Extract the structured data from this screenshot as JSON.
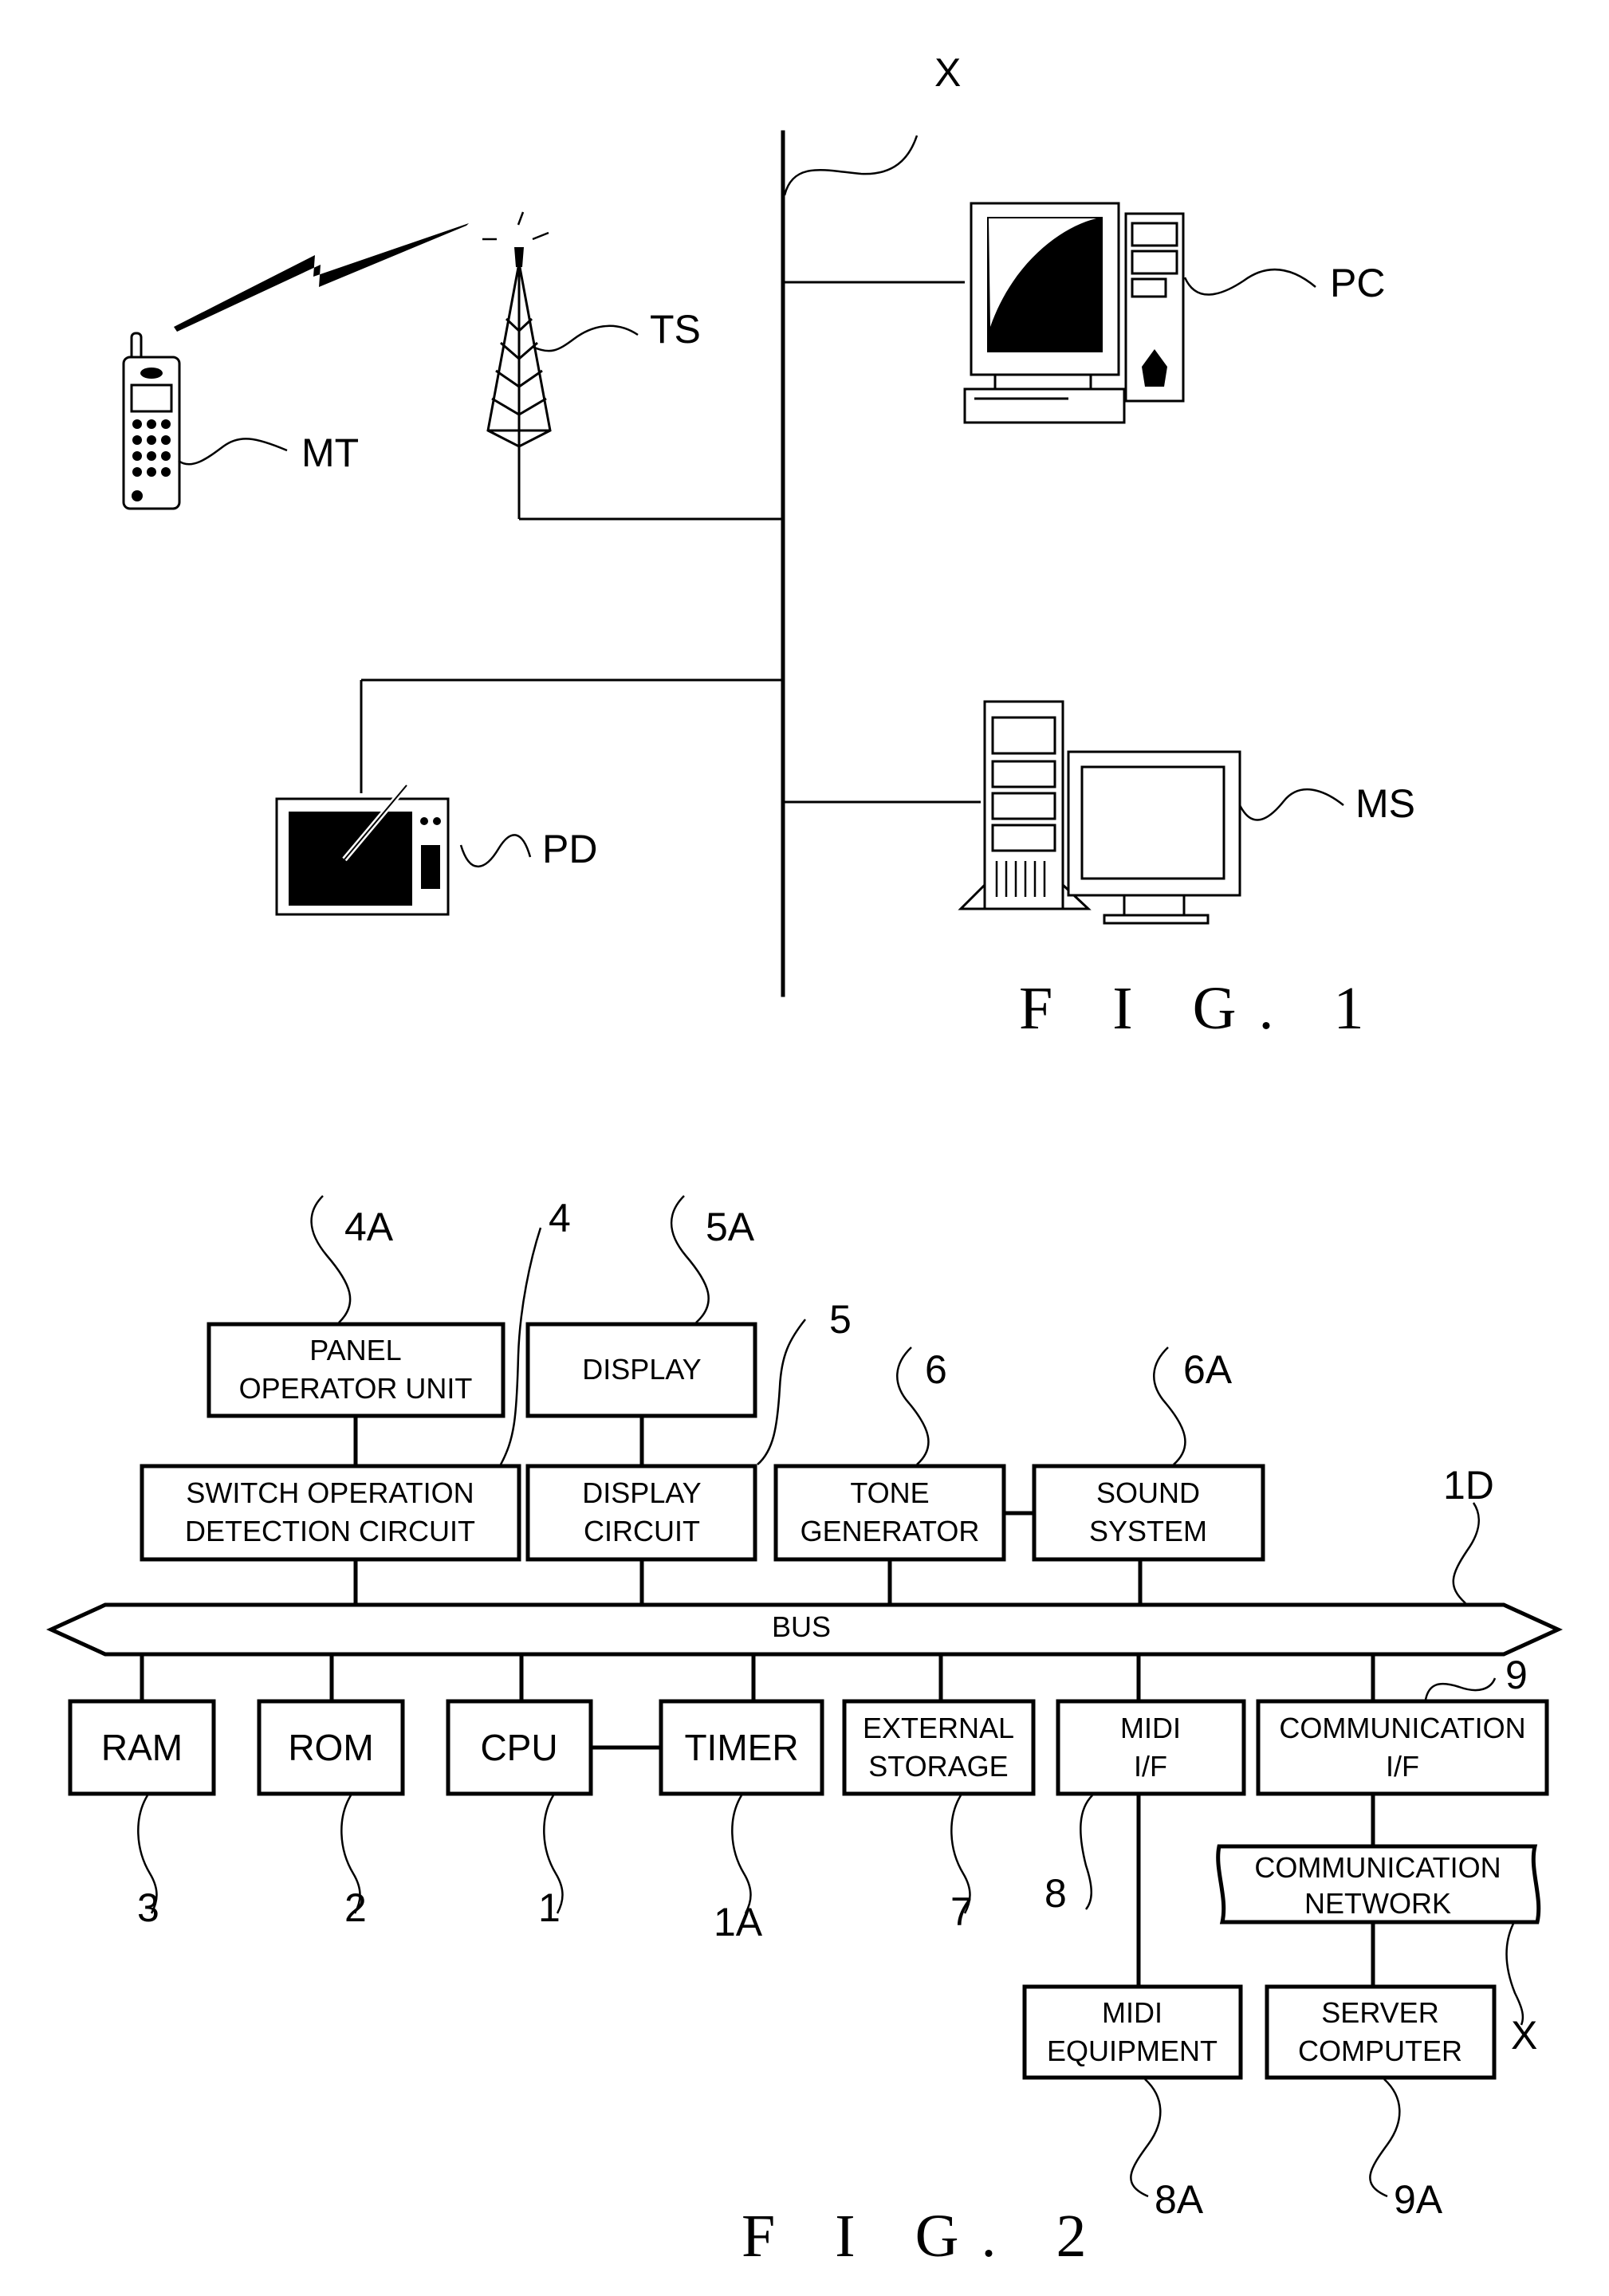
{
  "figure1": {
    "caption": "F I G.  1",
    "network_label": "X",
    "devices": [
      {
        "id": "MT",
        "label": "MT",
        "kind": "mobile-phone"
      },
      {
        "id": "TS",
        "label": "TS",
        "kind": "transmission-tower"
      },
      {
        "id": "PC",
        "label": "PC",
        "kind": "personal-computer"
      },
      {
        "id": "PD",
        "label": "PD",
        "kind": "pen-tablet-device"
      },
      {
        "id": "MS",
        "label": "MS",
        "kind": "server-computer"
      }
    ]
  },
  "figure2": {
    "caption": "F I G.  2",
    "bus": {
      "label": "BUS",
      "ref": "1D"
    },
    "upper_blocks": [
      {
        "lines": [
          "PANEL",
          "OPERATOR UNIT"
        ],
        "ref": "4A"
      },
      {
        "lines": [
          "DISPLAY"
        ],
        "ref": "5A"
      }
    ],
    "middle_blocks": [
      {
        "lines": [
          "SWITCH OPERATION",
          "DETECTION CIRCUIT"
        ],
        "ref": "4"
      },
      {
        "lines": [
          "DISPLAY",
          "CIRCUIT"
        ],
        "ref": "5"
      },
      {
        "lines": [
          "TONE",
          "GENERATOR"
        ],
        "ref": "6"
      },
      {
        "lines": [
          "SOUND",
          "SYSTEM"
        ],
        "ref": "6A"
      }
    ],
    "lower_blocks": [
      {
        "lines": [
          "RAM"
        ],
        "ref": "3"
      },
      {
        "lines": [
          "ROM"
        ],
        "ref": "2"
      },
      {
        "lines": [
          "CPU"
        ],
        "ref": "1"
      },
      {
        "lines": [
          "TIMER"
        ],
        "ref": "1A"
      },
      {
        "lines": [
          "EXTERNAL",
          "STORAGE"
        ],
        "ref": "7"
      },
      {
        "lines": [
          "MIDI",
          "I/F"
        ],
        "ref": "8"
      },
      {
        "lines": [
          "COMMUNICATION",
          "I/F"
        ],
        "ref": "9"
      }
    ],
    "network_block": {
      "lines": [
        "COMMUNICATION",
        "NETWORK"
      ],
      "ref": "X"
    },
    "external_blocks": [
      {
        "lines": [
          "MIDI",
          "EQUIPMENT"
        ],
        "ref": "8A"
      },
      {
        "lines": [
          "SERVER",
          "COMPUTER"
        ],
        "ref": "9A"
      }
    ]
  }
}
